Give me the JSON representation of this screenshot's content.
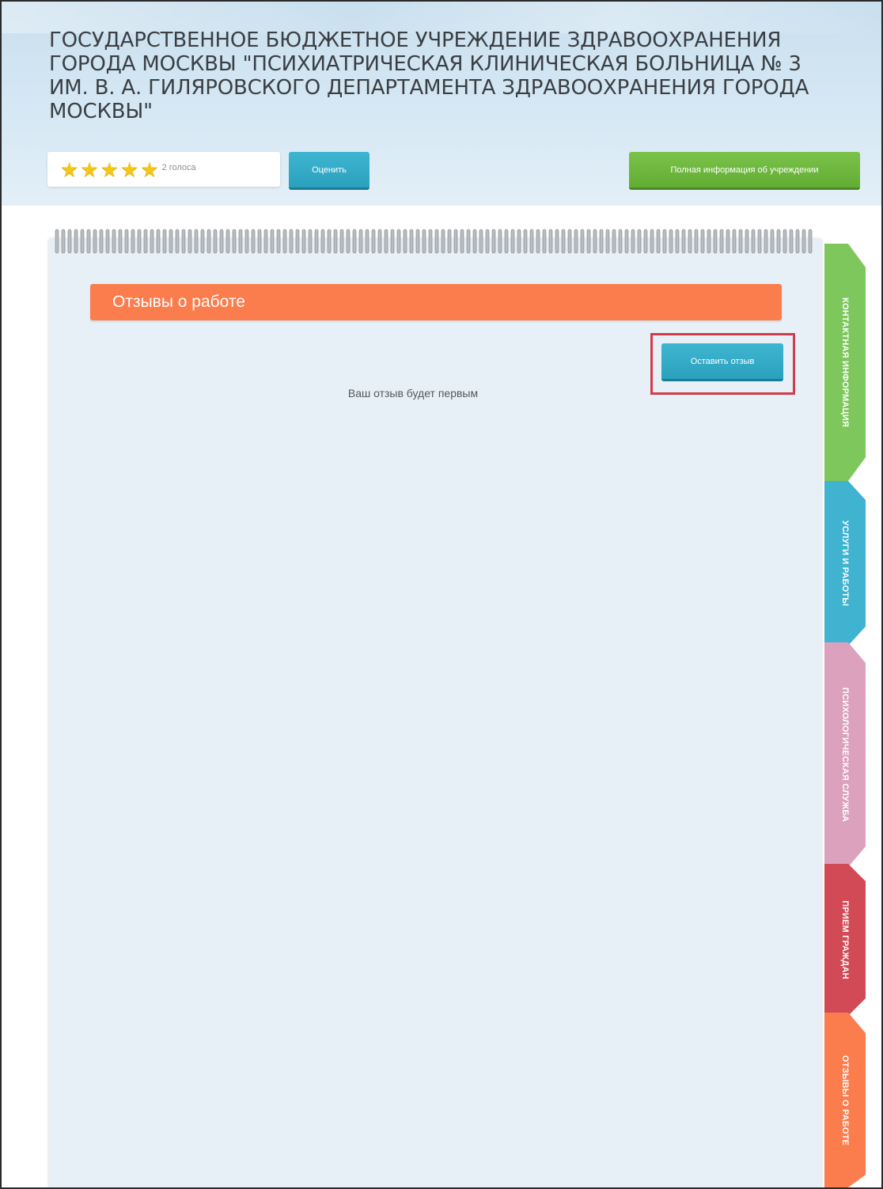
{
  "header": {
    "org_title": "ГОСУДАРСТВЕННОЕ БЮДЖЕТНОЕ УЧРЕЖДЕНИЕ ЗДРАВООХРАНЕНИЯ ГОРОДА МОСКВЫ \"ПСИХИАТРИЧЕСКАЯ КЛИНИЧЕСКАЯ БОЛЬНИЦА № 3 ИМ. В. А. ГИЛЯРОВСКОГО ДЕПАРТАМЕНТА ЗДРАВООХРАНЕНИЯ ГОРОДА МОСКВЫ\"",
    "rating": {
      "stars_filled": 5,
      "stars_total": 5,
      "votes_label": "2 голоса",
      "star_color": "#f5c518"
    },
    "rate_button_label": "Оценить",
    "full_info_button_label": "Полная информация об учреждении"
  },
  "main": {
    "section_title": "Отзывы о работе",
    "add_review_button_label": "Оставить отзыв",
    "empty_message": "Ваш отзыв будет первым"
  },
  "side_tabs": [
    {
      "label": "КОНТАКТНАЯ ИНФОРМАЦИЯ",
      "color": "#7dc75c"
    },
    {
      "label": "УСЛУГИ И РАБОТЫ",
      "color": "#3fb3cf"
    },
    {
      "label": "ПСИХОЛОГИЧЕСКАЯ СЛУЖБА",
      "color": "#dba1bd"
    },
    {
      "label": "ПРИЕМ ГРАЖДАН",
      "color": "#d24a56"
    },
    {
      "label": "ОТЗЫВЫ О РАБОТЕ",
      "color": "#fb7c4c"
    }
  ],
  "colors": {
    "accent_orange": "#fb7c4c",
    "button_blue": "#2aa0bd",
    "button_green": "#62ad33",
    "highlight_red": "#d43b4a",
    "notebook_bg": "#e6f0f6"
  }
}
